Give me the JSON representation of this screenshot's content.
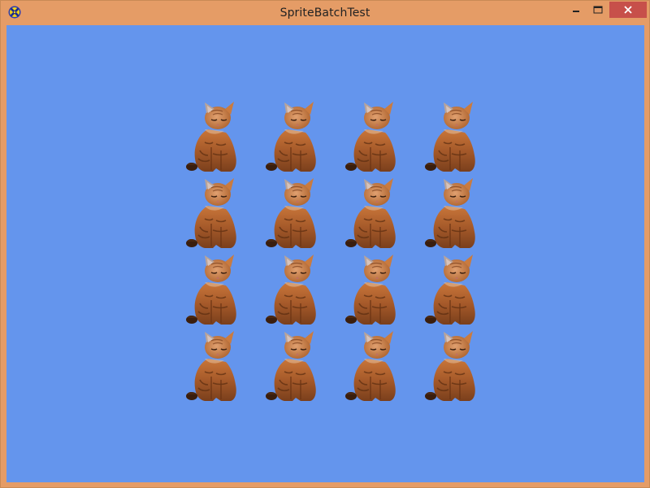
{
  "window": {
    "title": "SpriteBatchTest",
    "frame_color": "#e59c66",
    "client_color": "#6495ed",
    "close_color": "#c7504a",
    "app_icon": "xna-logo-icon"
  },
  "sprite_grid": {
    "rows": 4,
    "columns": 4,
    "sprite": "orange-tabby-cat-sprite"
  }
}
